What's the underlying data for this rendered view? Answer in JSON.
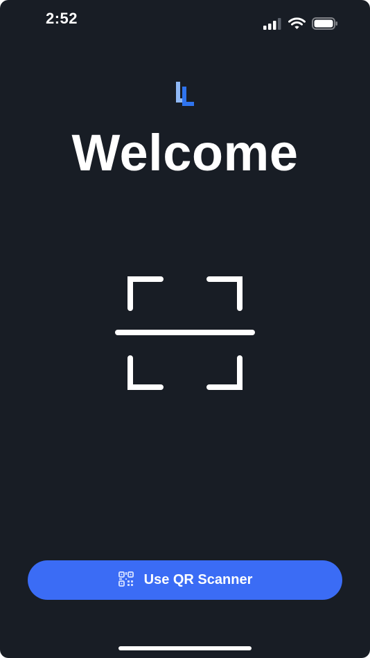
{
  "status_bar": {
    "time": "2:52",
    "icons": [
      "cellular-signal-icon",
      "wifi-icon",
      "battery-icon"
    ]
  },
  "header": {
    "logo": "app-logo",
    "title": "Welcome"
  },
  "main": {
    "illustration": "qr-scan-frame-icon"
  },
  "footer": {
    "scan_button_label": "Use QR Scanner",
    "scan_button_icon": "qr-code-icon"
  },
  "colors": {
    "background": "#181d25",
    "accent": "#3b6cf5",
    "logo_light": "#8fb8f5",
    "logo_dark": "#2f74ee",
    "text": "#ffffff"
  }
}
